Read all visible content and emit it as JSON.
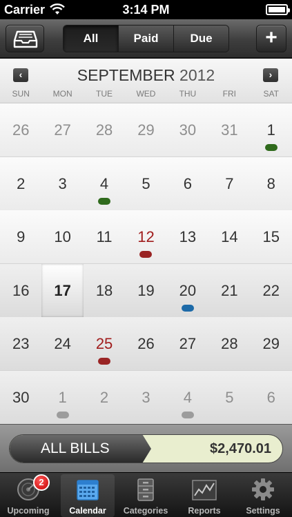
{
  "status_bar": {
    "carrier": "Carrier",
    "time": "3:14 PM"
  },
  "toolbar": {
    "segments": [
      {
        "label": "All",
        "active": true
      },
      {
        "label": "Paid",
        "active": false
      },
      {
        "label": "Due",
        "active": false
      }
    ],
    "add_label": "+"
  },
  "calendar": {
    "month": "SEPTEMBER",
    "year": "2012",
    "weekdays": [
      "SUN",
      "MON",
      "TUE",
      "WED",
      "THU",
      "FRI",
      "SAT"
    ],
    "weeks": [
      [
        {
          "d": "26",
          "other": true
        },
        {
          "d": "27",
          "other": true
        },
        {
          "d": "28",
          "other": true
        },
        {
          "d": "29",
          "other": true
        },
        {
          "d": "30",
          "other": true
        },
        {
          "d": "31",
          "other": true
        },
        {
          "d": "1",
          "dot": "green"
        }
      ],
      [
        {
          "d": "2"
        },
        {
          "d": "3"
        },
        {
          "d": "4",
          "dot": "green"
        },
        {
          "d": "5"
        },
        {
          "d": "6"
        },
        {
          "d": "7"
        },
        {
          "d": "8"
        }
      ],
      [
        {
          "d": "9"
        },
        {
          "d": "10"
        },
        {
          "d": "11"
        },
        {
          "d": "12",
          "red": true,
          "dot": "red"
        },
        {
          "d": "13"
        },
        {
          "d": "14"
        },
        {
          "d": "15"
        }
      ],
      [
        {
          "d": "16"
        },
        {
          "d": "17",
          "today": true
        },
        {
          "d": "18"
        },
        {
          "d": "19"
        },
        {
          "d": "20",
          "dot": "blue"
        },
        {
          "d": "21"
        },
        {
          "d": "22"
        }
      ],
      [
        {
          "d": "23"
        },
        {
          "d": "24"
        },
        {
          "d": "25",
          "red": true,
          "dot": "red"
        },
        {
          "d": "26"
        },
        {
          "d": "27"
        },
        {
          "d": "28"
        },
        {
          "d": "29"
        }
      ],
      [
        {
          "d": "30"
        },
        {
          "d": "1",
          "other": true,
          "dot": "gray"
        },
        {
          "d": "2",
          "other": true
        },
        {
          "d": "3",
          "other": true
        },
        {
          "d": "4",
          "other": true,
          "dot": "gray"
        },
        {
          "d": "5",
          "other": true
        },
        {
          "d": "6",
          "other": true
        }
      ]
    ]
  },
  "dot_colors": {
    "green": "#2f6a1c",
    "red": "#9a2424",
    "blue": "#1d6aa8",
    "gray": "#9c9c9c"
  },
  "summary": {
    "label": "ALL BILLS",
    "total": "$2,470.01"
  },
  "tabs": [
    {
      "label": "Upcoming",
      "icon": "radar-icon",
      "badge": "2"
    },
    {
      "label": "Calendar",
      "icon": "calendar-icon",
      "active": true
    },
    {
      "label": "Categories",
      "icon": "cabinet-icon"
    },
    {
      "label": "Reports",
      "icon": "chart-icon"
    },
    {
      "label": "Settings",
      "icon": "gear-icon"
    }
  ]
}
